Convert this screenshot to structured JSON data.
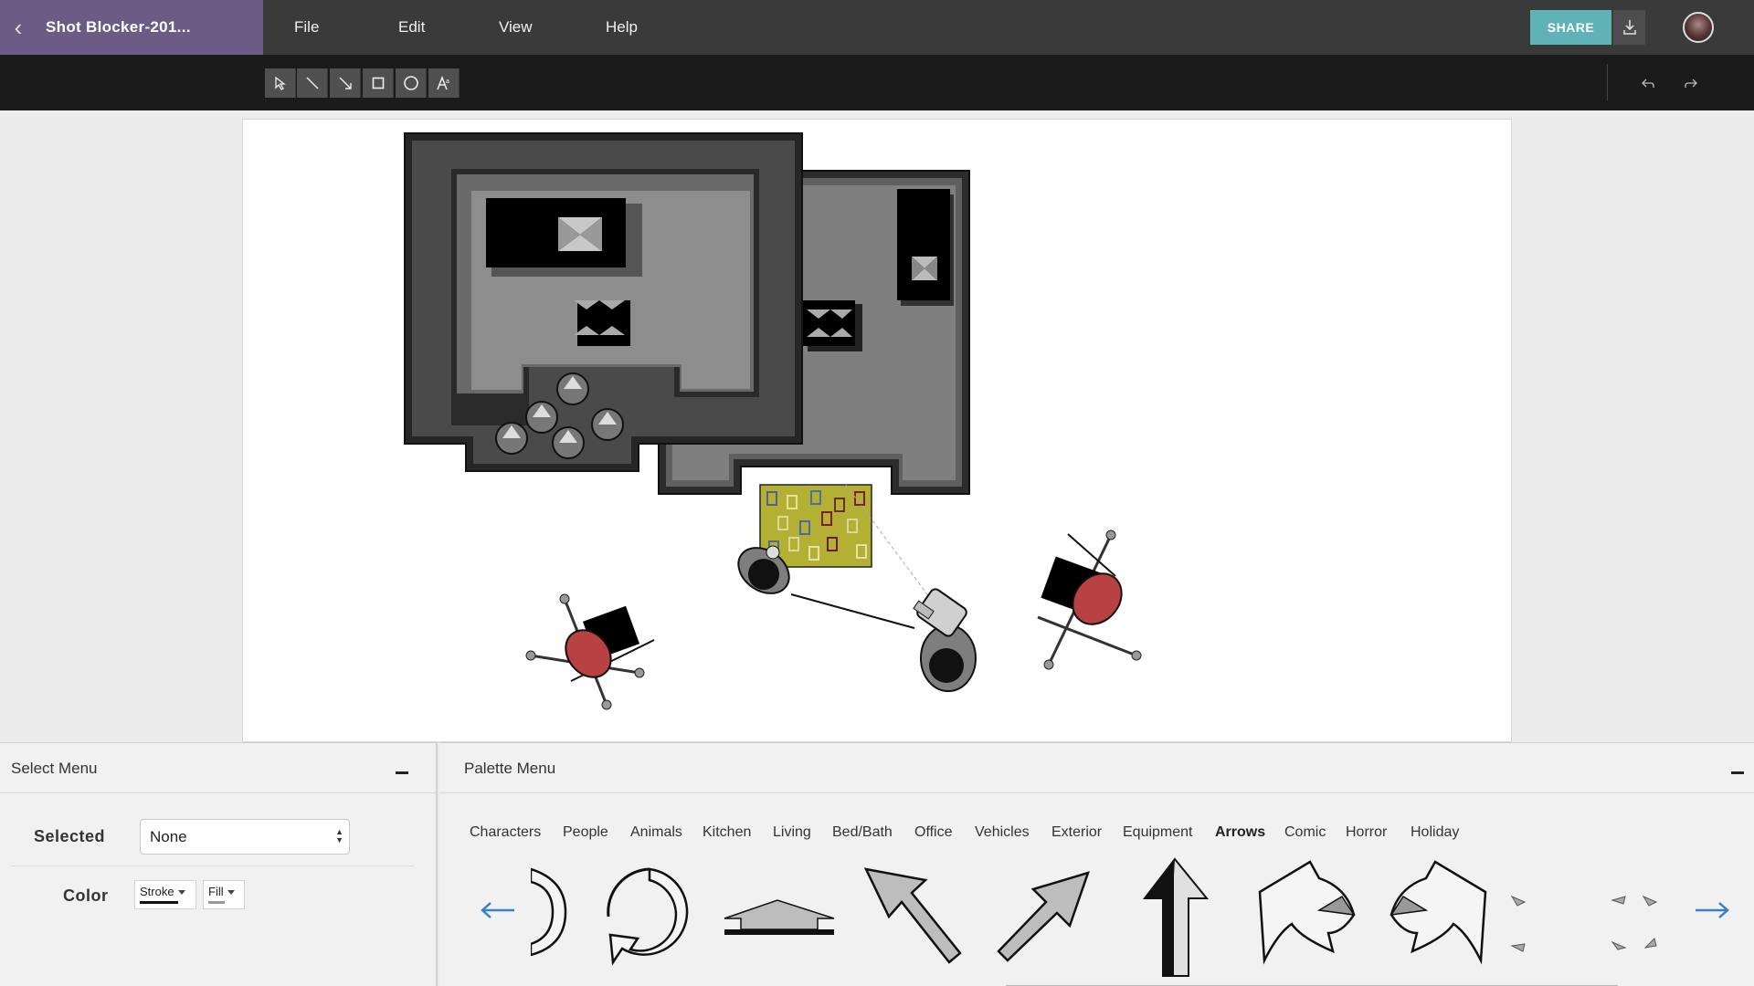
{
  "header": {
    "back_icon": "chevron-left-icon",
    "document_title": "Shot Blocker-201...",
    "menu": [
      "File",
      "Edit",
      "View",
      "Help"
    ],
    "share_label": "SHARE",
    "download_icon": "download-icon",
    "avatar": "user-avatar"
  },
  "toolbar": {
    "tools": [
      "select-tool",
      "line-tool",
      "arrow-tool",
      "rectangle-tool",
      "ellipse-tool",
      "text-tool"
    ],
    "undo_icon": "undo-icon",
    "redo_icon": "redo-icon"
  },
  "canvas": {
    "description_items": [
      "building-floorplan",
      "rug",
      "actor-standing",
      "actor-sitting",
      "camera-operator",
      "light-stand-left",
      "light-stand-right",
      "sightline"
    ]
  },
  "select_menu": {
    "title": "Select Menu",
    "selected_label": "Selected",
    "selected_value": "None",
    "color_label": "Color",
    "stroke_label": "Stroke",
    "fill_label": "Fill",
    "stroke_color": "#111111",
    "fill_color": "#999999"
  },
  "palette_menu": {
    "title": "Palette Menu",
    "categories": [
      "Characters",
      "People",
      "Animals",
      "Kitchen",
      "Living",
      "Bed/Bath",
      "Office",
      "Vehicles",
      "Exterior",
      "Equipment",
      "Arrows",
      "Comic",
      "Horror",
      "Holiday"
    ],
    "active_category": "Arrows",
    "prev_icon": "arrow-left-icon",
    "next_icon": "arrow-right-icon",
    "accent_color": "#3a7fc0"
  },
  "colors": {
    "title_bar": "#6b5b85",
    "share": "#5fb3b6",
    "topbar": "#3a3a3a",
    "toolbar": "#1b1b1b"
  }
}
